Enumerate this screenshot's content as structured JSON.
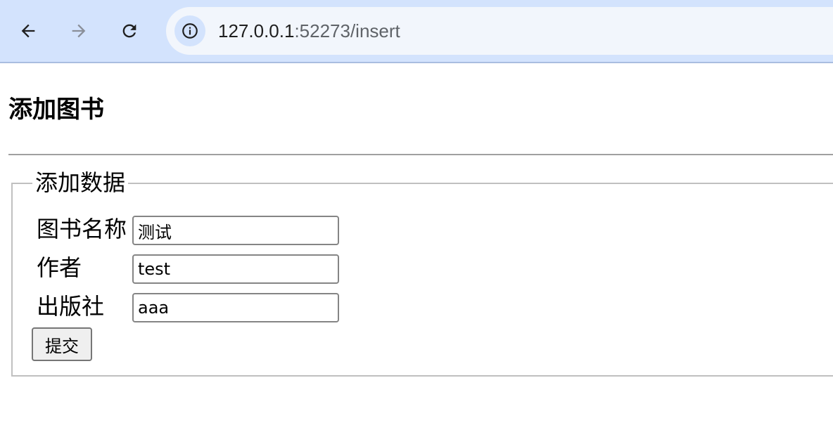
{
  "browser": {
    "icons": {
      "back": "arrow-left-icon",
      "forward": "arrow-right-icon",
      "reload": "reload-icon",
      "site_info": "info-icon"
    },
    "url_host": "127.0.0.1",
    "url_rest": ":52273/insert"
  },
  "page": {
    "title": "添加图书",
    "form": {
      "legend": "添加数据",
      "fields": [
        {
          "label": "图书名称",
          "value": "测试"
        },
        {
          "label": "作者",
          "value": "test"
        },
        {
          "label": "出版社",
          "value": "aaa"
        }
      ],
      "submit_label": "提交"
    }
  },
  "colors": {
    "toolbar_bg": "#d3e3fd",
    "address_bg": "#f2f6fc"
  }
}
